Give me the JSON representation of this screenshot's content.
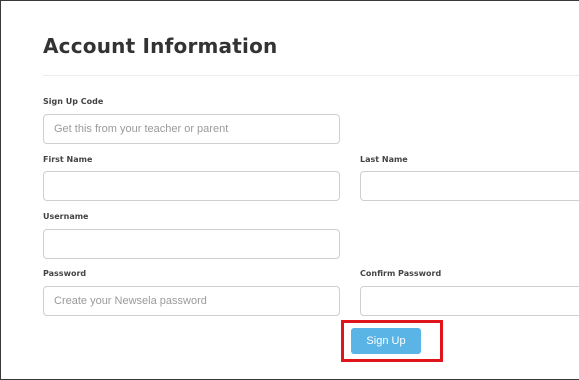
{
  "form": {
    "title": "Account Information",
    "signup_code": {
      "label": "Sign Up Code",
      "value": "",
      "placeholder": "Get this from your teacher or parent"
    },
    "first_name": {
      "label": "First Name",
      "value": "",
      "placeholder": ""
    },
    "last_name": {
      "label": "Last Name",
      "value": "",
      "placeholder": ""
    },
    "username": {
      "label": "Username",
      "value": "",
      "placeholder": ""
    },
    "password": {
      "label": "Password",
      "value": "",
      "placeholder": "Create your Newsela password"
    },
    "confirm_password": {
      "label": "Confirm Password",
      "value": "",
      "placeholder": ""
    },
    "submit_label": "Sign Up"
  },
  "annotation": {
    "highlight_color": "#e0141b"
  },
  "colors": {
    "button": "#5ab4e5",
    "input_border": "#cfcfcf",
    "title_text": "#333333"
  }
}
